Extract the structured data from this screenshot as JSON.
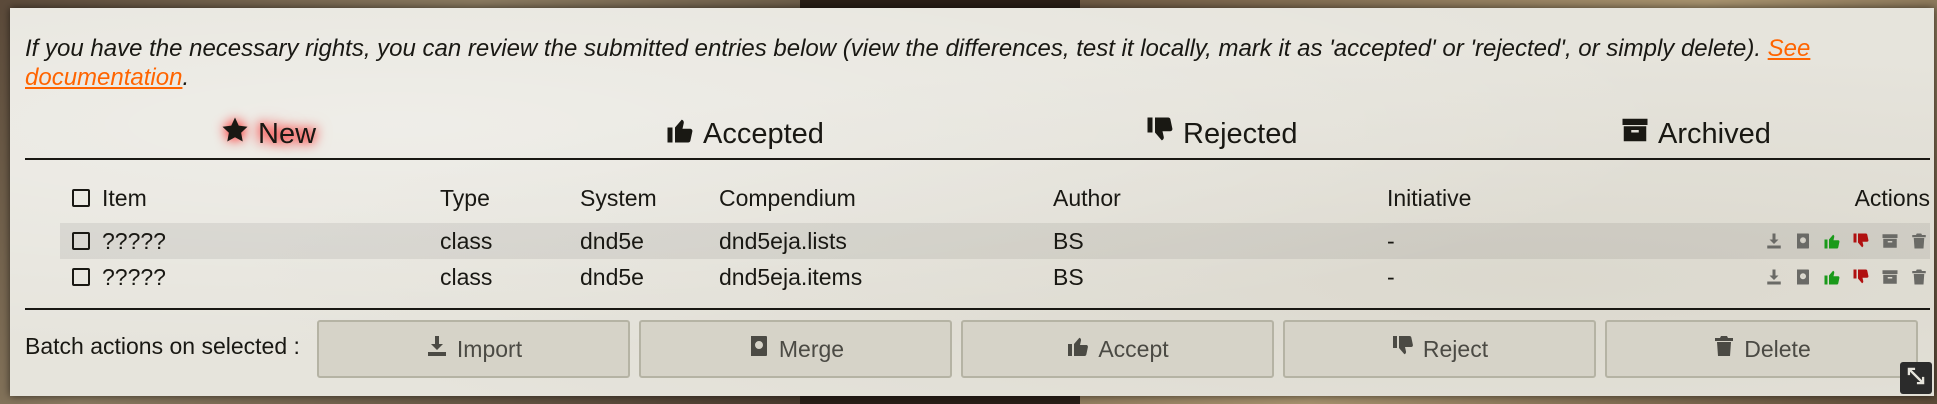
{
  "intro": {
    "text": "If you have the necessary rights, you can review the submitted entries below (view the differences, test it locally, mark it as 'accepted' or 'rejected', or simply delete). ",
    "link_text": "See documentation",
    "suffix": "."
  },
  "tabs": [
    {
      "label": "New",
      "icon": "star-icon",
      "active": true
    },
    {
      "label": "Accepted",
      "icon": "thumbs-up-icon",
      "active": false
    },
    {
      "label": "Rejected",
      "icon": "thumbs-down-icon",
      "active": false
    },
    {
      "label": "Archived",
      "icon": "archive-icon",
      "active": false
    }
  ],
  "table": {
    "headers": {
      "item": "Item",
      "type": "Type",
      "system": "System",
      "compendium": "Compendium",
      "author": "Author",
      "initiative": "Initiative",
      "actions": "Actions"
    },
    "rows": [
      {
        "item": "?????",
        "type": "class",
        "system": "dnd5e",
        "compendium": "dnd5eja.lists",
        "author": "BS",
        "initiative": "-"
      },
      {
        "item": "?????",
        "type": "class",
        "system": "dnd5e",
        "compendium": "dnd5eja.items",
        "author": "BS",
        "initiative": "-"
      }
    ],
    "row_actions": [
      "download-icon",
      "merge-book-icon",
      "accept-thumbs-up-icon",
      "reject-thumbs-down-icon",
      "archive-icon",
      "trash-icon"
    ]
  },
  "batch": {
    "label": "Batch actions on selected :",
    "buttons": [
      {
        "label": "Import",
        "icon": "download-icon"
      },
      {
        "label": "Merge",
        "icon": "merge-book-icon"
      },
      {
        "label": "Accept",
        "icon": "thumbs-up-icon"
      },
      {
        "label": "Reject",
        "icon": "thumbs-down-icon"
      },
      {
        "label": "Delete",
        "icon": "trash-icon"
      }
    ]
  },
  "colors": {
    "link": "#ff6400",
    "active_glow": "#ff0000",
    "accept": "#1a9a1a",
    "reject": "#b01010",
    "panel_bg": "#e6e4dc"
  }
}
